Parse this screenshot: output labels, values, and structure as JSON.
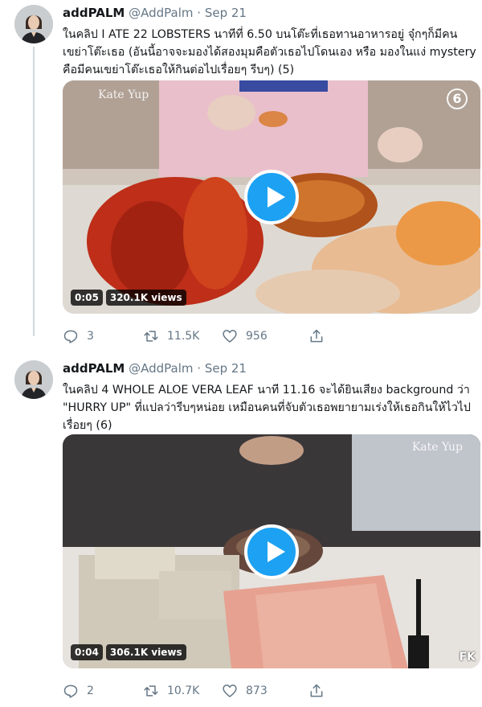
{
  "tweets": [
    {
      "author": {
        "name": "addPALM",
        "handle": "@AddPalm",
        "separator": "·",
        "date": "Sep 21"
      },
      "text": "ในคลิป I ATE 22 LOBSTERS นาทีที่ 6.50 บนโต๊ะที่เธอทานอาหารอยู่ จุ๋กๆก็มีคนเขย่าโต๊ะเธอ (อันนี้อาจจะมองได้สองมุมคือตัวเธอไปโดนเอง หรือ มองในแง่ mystery คือมีคนเขย่าโต๊ะเธอให้กินต่อไปเรื่อยๆ รีบๆ) (5)",
      "video": {
        "watermark": "Kate Yup",
        "corner_mark": "6",
        "duration": "0:05",
        "views": "320.1K views"
      },
      "stats": {
        "replies": "3",
        "retweets": "11.5K",
        "likes": "956"
      }
    },
    {
      "author": {
        "name": "addPALM",
        "handle": "@AddPalm",
        "separator": "·",
        "date": "Sep 21"
      },
      "text": "ในคลิป 4 WHOLE ALOE VERA LEAF นาที 11.16 จะได้ยินเสียง background ว่า \"HURRY UP\" ที่แปลว่ารีบๆหน่อย เหมือนคนที่จับตัวเธอพยายามเร่งให้เธอกินให้ไวไปเรื่อยๆ (6)",
      "video": {
        "watermark": "Kate Yup",
        "corner_mark": "FK",
        "duration": "0:04",
        "views": "306.1K views"
      },
      "stats": {
        "replies": "2",
        "retweets": "10.7K",
        "likes": "873"
      }
    }
  ],
  "icons": {
    "reply": "reply-icon",
    "retweet": "retweet-icon",
    "like": "heart-icon",
    "share": "share-icon",
    "play": "play-icon"
  },
  "colors": {
    "accent": "#1da1f2",
    "text_primary": "#14171a",
    "text_secondary": "#657786",
    "thread_line": "#cfd9de"
  }
}
